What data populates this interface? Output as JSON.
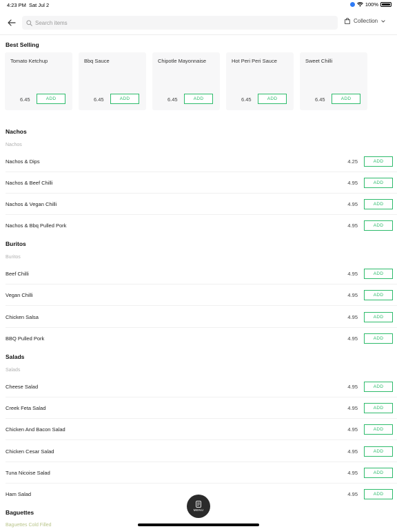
{
  "status_bar": {
    "time": "4:23 PM",
    "date": "Sat Jul 2",
    "battery": "100%"
  },
  "header": {
    "search_placeholder": "Search items",
    "collection_label": "Collection"
  },
  "best_selling": {
    "title": "Best Selling",
    "items": [
      {
        "name": "Tomato Ketchup",
        "price": "6.45",
        "add": "ADD"
      },
      {
        "name": "Bbq Sauce",
        "price": "6.45",
        "add": "ADD"
      },
      {
        "name": "Chipotle Mayonnaise",
        "price": "6.45",
        "add": "ADD"
      },
      {
        "name": "Hot Peri Peri Sauce",
        "price": "6.45",
        "add": "ADD"
      },
      {
        "name": "Sweet Chilli",
        "price": "6.45",
        "add": "ADD"
      }
    ]
  },
  "nachos": {
    "title": "Nachos",
    "subtitle": "Nachos",
    "items": [
      {
        "name": "Nachos & Dips",
        "price": "4.25",
        "add": "ADD"
      },
      {
        "name": "Nachos & Beef Chilli",
        "price": "4.95",
        "add": "ADD"
      },
      {
        "name": "Nachos & Vegan Chilli",
        "price": "4.95",
        "add": "ADD"
      },
      {
        "name": "Nachos & Bbq Pulled Pork",
        "price": "4.95",
        "add": "ADD"
      }
    ]
  },
  "burritos": {
    "title": "Buritos",
    "subtitle": "Buritos",
    "items": [
      {
        "name": "Beef Chilli",
        "price": "4.95",
        "add": "ADD"
      },
      {
        "name": "Vegan Chilli",
        "price": "4.95",
        "add": "ADD"
      },
      {
        "name": "Chicken Salsa",
        "price": "4.95",
        "add": "ADD"
      },
      {
        "name": "BBQ Pulled Pork",
        "price": "4.95",
        "add": "ADD"
      }
    ]
  },
  "salads": {
    "title": "Salads",
    "subtitle": "Salads",
    "items": [
      {
        "name": "Cheese Salad",
        "price": "4.95",
        "add": "ADD"
      },
      {
        "name": "Creek Feta Salad",
        "price": "4.95",
        "add": "ADD"
      },
      {
        "name": "Chicken And Bacon Salad",
        "price": "4.95",
        "add": "ADD"
      },
      {
        "name": "Chicken Cesar Salad",
        "price": "4.95",
        "add": "ADD"
      },
      {
        "name": "Tuna Nicoise Salad",
        "price": "4.95",
        "add": "ADD"
      },
      {
        "name": "Ham Salad",
        "price": "4.95",
        "add": "ADD"
      }
    ]
  },
  "baguettes": {
    "title": "Baguettes",
    "subtitle": "Baguettes Cold Filled"
  },
  "fab": {
    "label": "MENU"
  },
  "colors": {
    "accent": "#2dbb6b",
    "fab": "#2b2b2b"
  },
  "icons": {
    "back": "arrow-left-icon",
    "search": "search-icon",
    "bag": "shopping-bag-icon",
    "chevron": "chevron-down-icon",
    "menu": "menu-book-icon"
  }
}
